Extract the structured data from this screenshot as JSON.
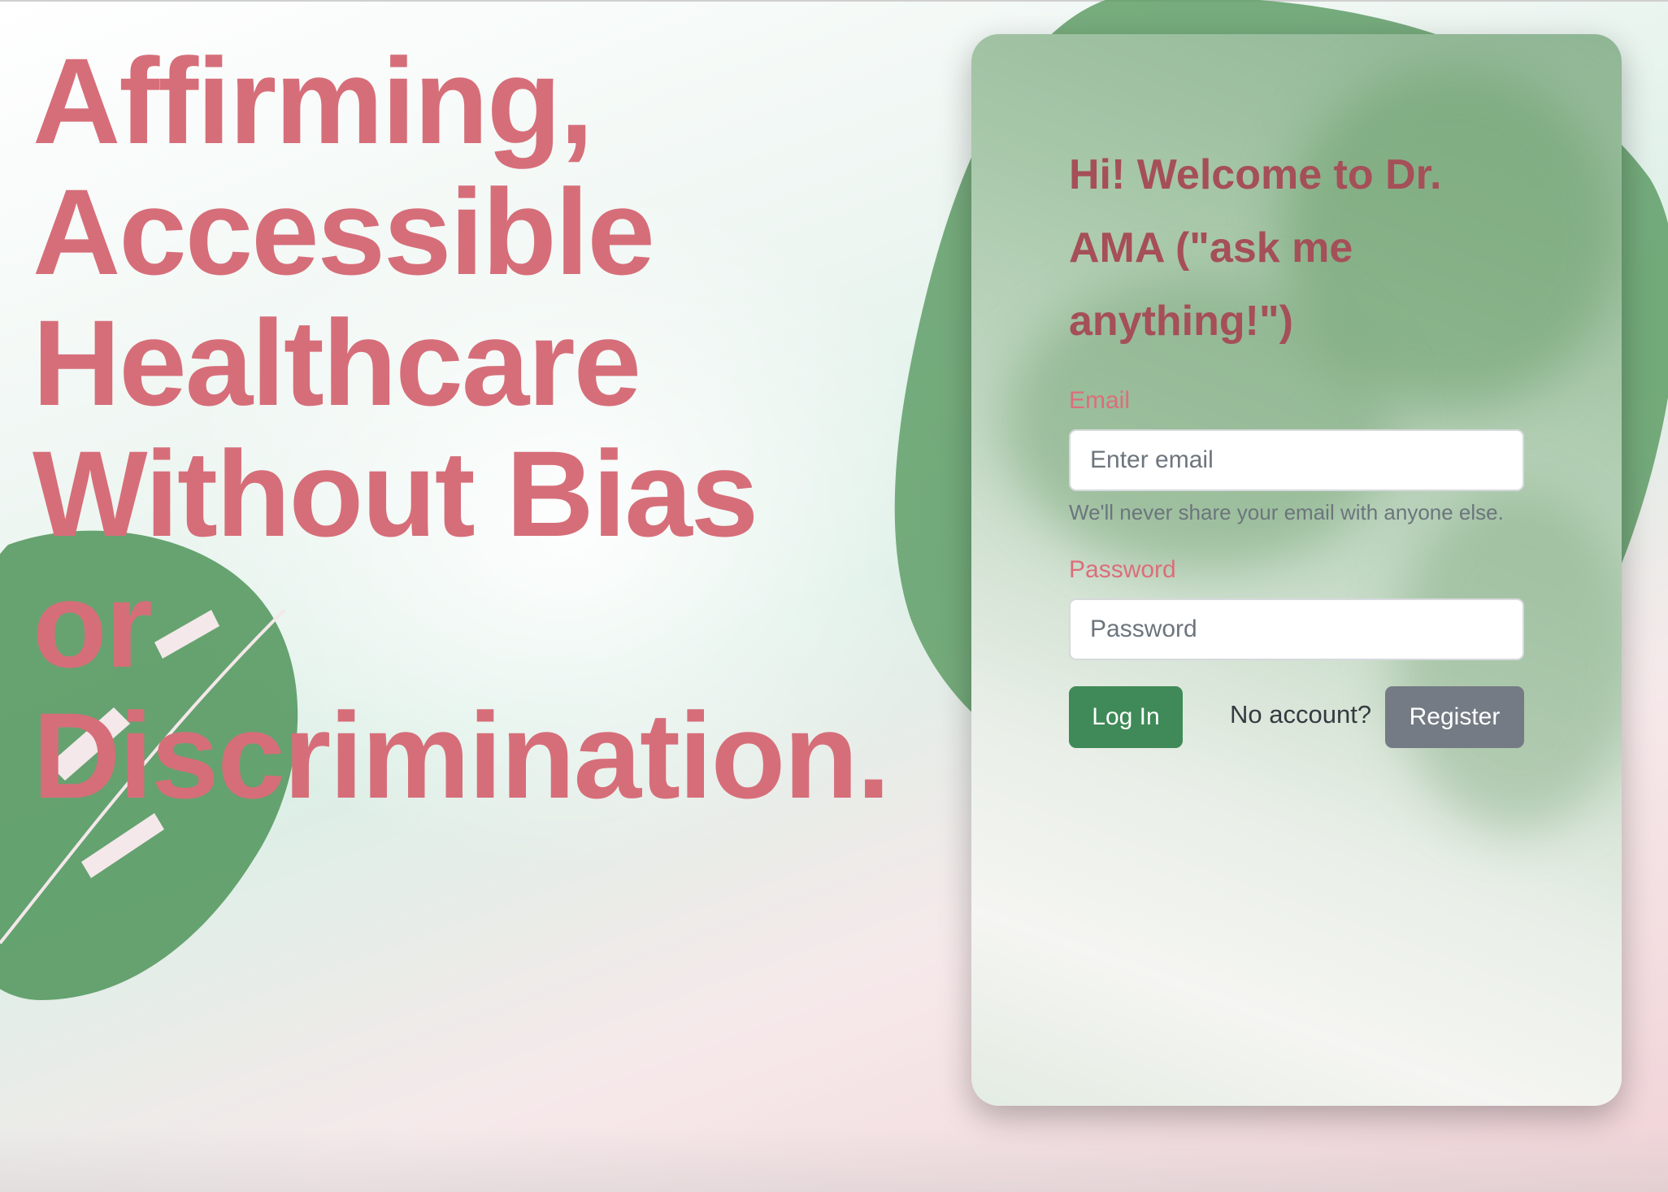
{
  "hero": {
    "line1": "Affirming,",
    "line2": "Accessible",
    "line3": "Healthcare",
    "line4": "Without Bias",
    "line5": "or",
    "line6": "Discrimination."
  },
  "login": {
    "title": "Hi! Welcome to Dr. AMA (\"ask me anything!\")",
    "email_label": "Email",
    "email_placeholder": "Enter email",
    "email_help": "We'll never share your email with anyone else.",
    "password_label": "Password",
    "password_placeholder": "Password",
    "login_button": "Log In",
    "no_account_text": "No account?",
    "register_button": "Register"
  },
  "colors": {
    "accent_pink": "#d66e79",
    "title_rose": "#a54f58",
    "login_green": "#3f8a58",
    "register_gray": "#747b84"
  }
}
